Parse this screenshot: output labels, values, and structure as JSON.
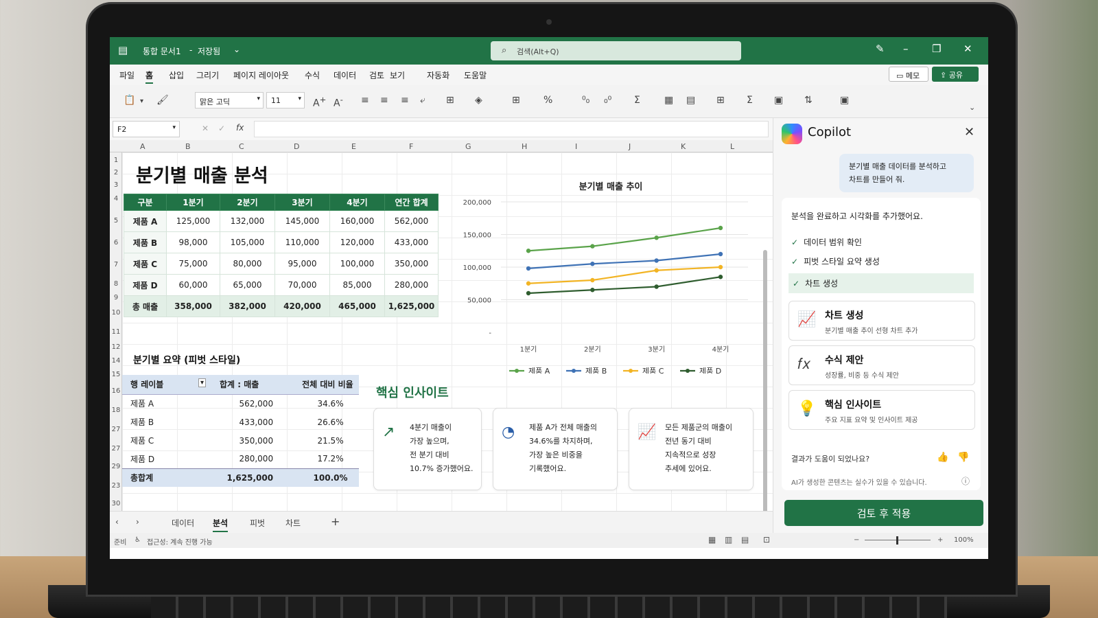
{
  "titlebar": {
    "doc_title": "통합 문서1",
    "separator": "-",
    "save_state": "저장됨",
    "search_placeholder": "검색(Alt+Q)"
  },
  "menu": [
    "파일",
    "홈",
    "삽입",
    "그리기",
    "페이지 레이아웃",
    "수식",
    "데이터",
    "검토",
    "보기",
    "자동화",
    "도움말"
  ],
  "menu_active": "홈",
  "actions": {
    "memo": "메모",
    "share": "공유"
  },
  "ribbon": {
    "font_name": "맑은 고딕",
    "font_size": "11"
  },
  "formula_bar": {
    "cell_ref": "F2",
    "fx": "fx"
  },
  "columns": [
    "A",
    "B",
    "C",
    "D",
    "E",
    "F",
    "G",
    "H",
    "I",
    "J",
    "K",
    "L"
  ],
  "rows": [
    "1",
    "2",
    "3",
    "4",
    "5",
    "6",
    "7",
    "8",
    "9",
    "10",
    "11",
    "12",
    "14",
    "15",
    "16",
    "18",
    "27",
    "27",
    "29",
    "23",
    "30",
    "30"
  ],
  "sheet_title": "분기별 매출 분석",
  "sales_table": {
    "headers": [
      "구분",
      "1분기",
      "2분기",
      "3분기",
      "4분기",
      "연간 합계"
    ],
    "rows": [
      [
        "제품 A",
        "125,000",
        "132,000",
        "145,000",
        "160,000",
        "562,000"
      ],
      [
        "제품 B",
        "98,000",
        "105,000",
        "110,000",
        "120,000",
        "433,000"
      ],
      [
        "제품 C",
        "75,000",
        "80,000",
        "95,000",
        "100,000",
        "350,000"
      ],
      [
        "제품 D",
        "60,000",
        "65,000",
        "70,000",
        "85,000",
        "280,000"
      ]
    ],
    "total": [
      "총 매출",
      "358,000",
      "382,000",
      "420,000",
      "465,000",
      "1,625,000"
    ]
  },
  "pivot": {
    "title": "분기별 요약 (피벗 스타일)",
    "headers": [
      "행 레이블",
      "합계 : 매출",
      "전체 대비 비율"
    ],
    "rows": [
      [
        "제품 A",
        "562,000",
        "34.6%"
      ],
      [
        "제품 B",
        "433,000",
        "26.6%"
      ],
      [
        "제품 C",
        "350,000",
        "21.5%"
      ],
      [
        "제품 D",
        "280,000",
        "17.2%"
      ]
    ],
    "total": [
      "총합계",
      "1,625,000",
      "100.0%"
    ]
  },
  "chart_data": {
    "type": "line",
    "title": "분기별 매출 추이",
    "categories": [
      "1분기",
      "2분기",
      "3분기",
      "4분기"
    ],
    "ylim": [
      0,
      200000
    ],
    "yticks": [
      "200,000",
      "150,000",
      "100,000",
      "50,000",
      "-"
    ],
    "ytick_values": [
      200000,
      150000,
      100000,
      50000,
      0
    ],
    "legend_position": "bottom",
    "grid": true,
    "series": [
      {
        "name": "제품 A",
        "values": [
          125000,
          132000,
          145000,
          160000
        ],
        "color": "#5aa34a"
      },
      {
        "name": "제품 B",
        "values": [
          98000,
          105000,
          110000,
          120000
        ],
        "color": "#3f72b5"
      },
      {
        "name": "제품 C",
        "values": [
          75000,
          80000,
          95000,
          100000
        ],
        "color": "#f2b424"
      },
      {
        "name": "제품 D",
        "values": [
          60000,
          65000,
          70000,
          85000
        ],
        "color": "#2f5d2f"
      }
    ]
  },
  "insights": {
    "title": "핵심 인사이트",
    "cards": [
      {
        "icon": "trend-up-icon",
        "lines": [
          "4분기 매출이",
          "가장 높으며,",
          "전 분기 대비",
          "10.7% 증가했어요."
        ]
      },
      {
        "icon": "pie-chart-icon",
        "lines": [
          "제품 A가 전체 매출의",
          "34.6%를 차지하며,",
          "가장 높은 비중을",
          "기록했어요."
        ]
      },
      {
        "icon": "line-chart-icon",
        "lines": [
          "모든 제품군의 매출이",
          "전년 동기 대비",
          "지속적으로 성장",
          "추세에 있어요."
        ]
      }
    ]
  },
  "sheet_tabs": [
    "데이터",
    "분석",
    "피벗",
    "차트"
  ],
  "sheet_active": "분석",
  "status": {
    "ready": "준비",
    "accessibility": "접근성: 계속 진행 가능",
    "zoom": "100%"
  },
  "copilot": {
    "title": "Copilot",
    "user_message_lines": [
      "분기별 매출 데이터를 분석하고",
      "차트를 만들어 줘."
    ],
    "intro": "분석을 완료하고 시각화를 추가했어요.",
    "checks": [
      "데이터 범위 확인",
      "피벗 스타일 요약 생성",
      "차트 생성"
    ],
    "actions": [
      {
        "title": "차트 생성",
        "subtitle": "분기별 매출 추이 선형 차트 추가",
        "icon": "line-chart-icon"
      },
      {
        "title": "수식 제안",
        "subtitle": "성장률, 비중 등 수식 제안",
        "icon": "fx-icon"
      },
      {
        "title": "핵심 인사이트",
        "subtitle": "주요 지표 요약 및 인사이트 제공",
        "icon": "lightbulb-icon"
      }
    ],
    "feedback_question": "결과가 도움이 되었나요?",
    "disclaimer": "AI가 생성한 콘텐츠는 실수가 있을 수 있습니다.",
    "apply_button": "검토 후 적용"
  }
}
